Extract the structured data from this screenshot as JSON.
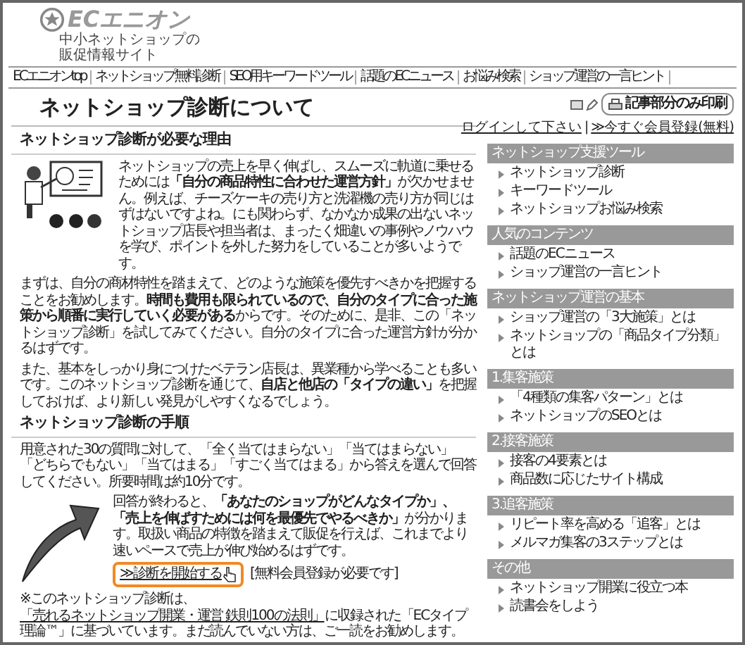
{
  "site": {
    "logo": "ECエニオン",
    "tagline": [
      "中小ネットショップの",
      "販促情報サイト"
    ]
  },
  "nav": [
    "ECエニオンtop",
    "ネットショップ無料診断",
    "SEO用キーワードツール",
    "話題のECニュース",
    "お悩み検索",
    "ショップ運営の一言ヒント"
  ],
  "page_title": "ネットショップ診断について",
  "print_button": "記事部分のみ印刷",
  "login": {
    "text": "ログインして下さい",
    "separator": "|",
    "register": "≫今すぐ会員登録(無料)"
  },
  "sections": [
    {
      "heading": "ネットショップ診断が必要な理由",
      "paragraphs": [
        {
          "kind": "illustrated",
          "text": "ネットショップの売上を早く伸ばし、スムーズに軌道に乗せるためには**「自分の商品特性に合わせた運営方針」**が欠かせません。例えば、チーズケーキの売り方と洗濯機の売り方が同じはずはないですよね。にも関わらず、なかなか成果の出ないネットショップ店長や担当者は、まったく畑違いの事例やノウハウを学び、ポイントを外した努力をしていることが多いようです。"
        },
        {
          "kind": "plain",
          "text": "まずは、自分の商材特性を踏まえて、どのような施策を優先すべきかを把握することをお勧めします。**時間も費用も限られているので、自分のタイプに合った施策から順番に実行していく必要がある**からです。そのために、是非、この「ネットショップ診断」を試してみてください。自分のタイプに合った運営方針が分かるはずです。"
        },
        {
          "kind": "plain",
          "text": "また、基本をしっかり身につけたベテラン店長は、異業種から学べることも多いです。このネットショップ診断を通じて、**自店と他店の「タイプの違い」**を把握しておけば、より新しい発見がしやすくなるでしょう。"
        }
      ]
    },
    {
      "heading": "ネットショップ診断の手順",
      "paragraphs": [
        {
          "kind": "plain",
          "text": "用意された30の質問に対して、「全く当てはまらない」「当てはまらない」「どちらでもない」「当てはまる」「すごく当てはまる」から答えを選んで回答してください。所要時間は約10分です。"
        },
        {
          "kind": "arrow",
          "text": "回答が終わると、**「あなたのショップがどんなタイプか」、「売上を伸ばすためには何を最優先でやるべきか」**が分かります。取扱い商品の特徴を踏まえて販促を行えば、これまでより速いペースで売上が伸び始めるはずです。"
        }
      ]
    }
  ],
  "cta": {
    "link": "≫診断を開始する",
    "note": "[無料会員登録が必要です]",
    "highlighted": true
  },
  "footnote": {
    "before": "※このネットショップ診断は、",
    "link": "「売れるネットショップ開業・運営 鉄則100の法則」",
    "after": "に収録された「ECタイプ理論™」に基づいています。まだ読んでいない方は、ご一読をお勧めします。"
  },
  "sidebar": [
    {
      "title": "ネットショップ支援ツール",
      "items": [
        "ネットショップ診断",
        "キーワードツール",
        "ネットショップお悩み検索"
      ]
    },
    {
      "title": "人気のコンテンツ",
      "items": [
        "話題のECニュース",
        "ショップ運営の一言ヒント"
      ]
    },
    {
      "title": "ネットショップ運営の基本",
      "items": [
        "ショップ運営の「3大施策」とは",
        "ネットショップの「商品タイプ分類」とは"
      ]
    },
    {
      "title": "1.集客施策",
      "items": [
        "「4種類の集客パターン」とは",
        "ネットショップのSEOとは"
      ]
    },
    {
      "title": "2.接客施策",
      "items": [
        "接客の4要素とは",
        "商品数に応じたサイト構成"
      ]
    },
    {
      "title": "3.追客施策",
      "items": [
        "リピート率を高める「追客」とは",
        "メルマガ集客の3ステップとは"
      ]
    },
    {
      "title": "その他",
      "items": [
        "ネットショップ開業に役立つ本",
        "読書会をしよう"
      ]
    }
  ]
}
